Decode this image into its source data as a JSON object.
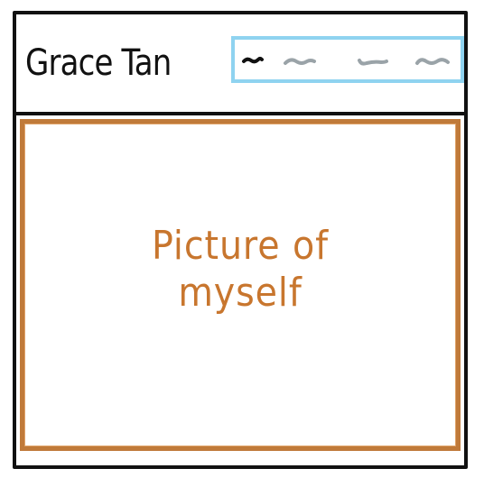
{
  "header": {
    "name": "Grace Tan",
    "nav": {
      "items": [
        {
          "icon": "nav-squiggle-active",
          "color": "#111111"
        },
        {
          "icon": "nav-squiggle",
          "color": "#9aa3a8"
        },
        {
          "icon": "nav-squiggle",
          "color": "#9aa3a8"
        },
        {
          "icon": "nav-squiggle",
          "color": "#9aa3a8"
        }
      ],
      "border_color": "#8fd3f0"
    }
  },
  "main": {
    "photo_placeholder": {
      "line1": "Picture of",
      "line2": "myself",
      "color": "#c8762e",
      "border_color": "#c07a3a"
    }
  }
}
